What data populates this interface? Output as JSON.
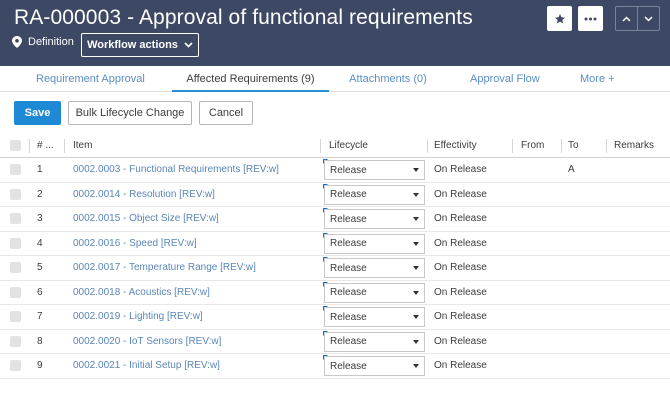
{
  "header": {
    "title": "RA-000003 - Approval of functional requirements",
    "definition_label": "Definition",
    "workflow_label": "Workflow actions"
  },
  "tabs": [
    {
      "label": "Requirement Approval",
      "active": false
    },
    {
      "label": "Affected Requirements (9)",
      "active": true
    },
    {
      "label": "Attachments (0)",
      "active": false
    },
    {
      "label": "Approval Flow",
      "active": false
    },
    {
      "label": "More +",
      "active": false
    }
  ],
  "toolbar": {
    "save_label": "Save",
    "bulk_label": "Bulk Lifecycle Change",
    "cancel_label": "Cancel"
  },
  "table": {
    "columns": {
      "num": "# ...",
      "item": "Item",
      "lifecycle": "Lifecycle",
      "effectivity": "Effectivity",
      "from": "From",
      "to": "To",
      "remarks": "Remarks"
    },
    "rows": [
      {
        "num": "1",
        "item": "0002.0003 - Functional Requirements [REV:w]",
        "lifecycle": "Release",
        "effectivity": "On Release",
        "from": "",
        "to": "A",
        "remarks": ""
      },
      {
        "num": "2",
        "item": "0002.0014 - Resolution [REV:w]",
        "lifecycle": "Release",
        "effectivity": "On Release",
        "from": "",
        "to": "",
        "remarks": ""
      },
      {
        "num": "3",
        "item": "0002.0015 - Object Size [REV:w]",
        "lifecycle": "Release",
        "effectivity": "On Release",
        "from": "",
        "to": "",
        "remarks": ""
      },
      {
        "num": "4",
        "item": "0002.0016 - Speed [REV:w]",
        "lifecycle": "Release",
        "effectivity": "On Release",
        "from": "",
        "to": "",
        "remarks": ""
      },
      {
        "num": "5",
        "item": "0002.0017 - Temperature Range [REV:w]",
        "lifecycle": "Release",
        "effectivity": "On Release",
        "from": "",
        "to": "",
        "remarks": ""
      },
      {
        "num": "6",
        "item": "0002.0018 - Acoustics [REV:w]",
        "lifecycle": "Release",
        "effectivity": "On Release",
        "from": "",
        "to": "",
        "remarks": ""
      },
      {
        "num": "7",
        "item": "0002.0019 - Lighting [REV:w]",
        "lifecycle": "Release",
        "effectivity": "On Release",
        "from": "",
        "to": "",
        "remarks": ""
      },
      {
        "num": "8",
        "item": "0002.0020 - IoT Sensors [REV:w]",
        "lifecycle": "Release",
        "effectivity": "On Release",
        "from": "",
        "to": "",
        "remarks": ""
      },
      {
        "num": "9",
        "item": "0002.0021 - Initial Setup [REV:w]",
        "lifecycle": "Release",
        "effectivity": "On Release",
        "from": "",
        "to": "",
        "remarks": ""
      }
    ]
  },
  "colors": {
    "header_bg": "#3c4864",
    "accent": "#1e8ad6",
    "link": "#5a86b8"
  },
  "icons": {
    "definition": "location-pin-icon",
    "favorite": "star-icon",
    "more": "more-dots-icon",
    "prev": "chevron-up-icon",
    "next": "chevron-down-icon"
  }
}
